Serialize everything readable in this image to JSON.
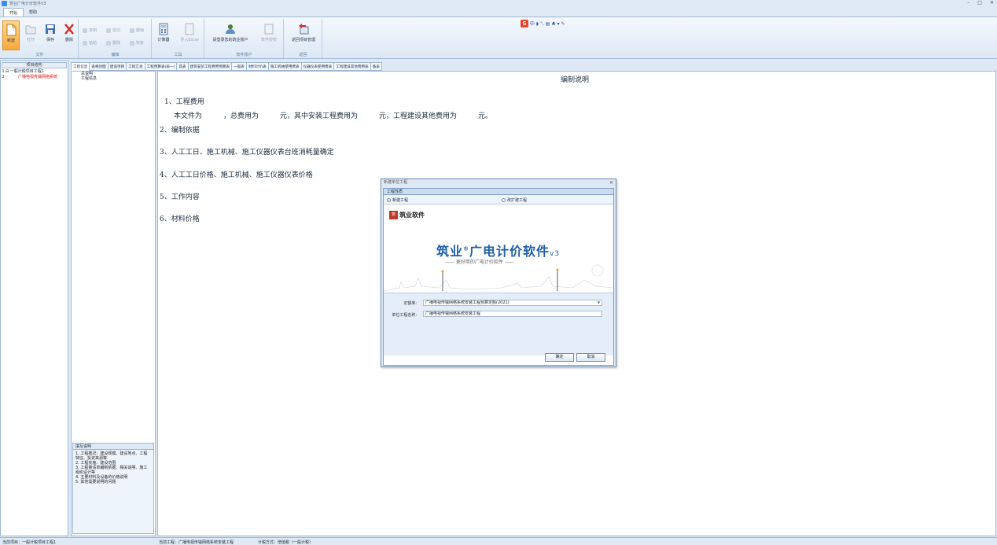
{
  "window": {
    "title": "筑业广电计价软件V3",
    "controls": [
      "–",
      "□",
      "✕"
    ]
  },
  "ribbon_tabs": [
    "开始",
    "帮助"
  ],
  "ribbon": {
    "file_group": {
      "label": "文件",
      "new": "新建",
      "open": "打开",
      "save": "保存",
      "delete": "删除"
    },
    "edit_group": {
      "label": "编辑",
      "copy": "复制",
      "paste": "粘贴",
      "cut": "剪切",
      "remove": "删除",
      "undo": "撤销",
      "redo": "恢复"
    },
    "tools_group": {
      "label": "工具",
      "calculator": "计算器",
      "import_excel": "导入Excel"
    },
    "account_group": {
      "label": "软件账户",
      "login": "请登录您的筑业账户",
      "auth": "软件授权"
    },
    "return_group": {
      "label": "返回",
      "back": "返回项目管理"
    }
  },
  "ime_toolbar": {
    "logo": "S",
    "glyphs": "中 ◗ °, ▤ ♣ ▾ ✎"
  },
  "left_panel": {
    "header": "项目结构",
    "items": [
      {
        "num": "1",
        "text": "⊟ 一般计税项目工程1"
      },
      {
        "num": "2",
        "text": "广播电视传输网络系统"
      }
    ]
  },
  "middle_panel": {
    "items": [
      "总说明",
      "工程信息"
    ],
    "notes_header": "填写说明",
    "notes": [
      "1. 工程概况：建设规模、建设地点、工程特征、投资来源等",
      "2. 工程实施、建设范围",
      "3. 工程量清单编制依据、相关说明、施工组织设计等",
      "4. 主要材料及设备的价格说明",
      "5. 其他需要说明的问题"
    ]
  },
  "doc_tabs": [
    "工程信息",
    "表格封面",
    "建设项目",
    "工程汇总",
    "工程预算表(表一)",
    "其表",
    "建筑安装工程费用预算表",
    "一般表",
    "材料计价表",
    "施工机械使用费表",
    "仪器仪表使用费表",
    "工程建设其他费用表",
    "备表"
  ],
  "document": {
    "title": "编制说明",
    "item1": "1、工程费用",
    "item1_body": "本文件为　　　，总费用为　　　元，其中安装工程费用为　　　元，工程建设其他费用为　　　元。",
    "item2": "2、编制依据",
    "item3": "3、人工工日、施工机械、施工仪器仪表台班消耗量确定",
    "item4": "4、人工工日价格、施工机械、施工仪器仪表价格",
    "item5": "5、工作内容",
    "item6": "6、材料价格"
  },
  "dialog": {
    "title": "新建单位工程",
    "close": "✕",
    "subheader": "工程性质",
    "radio_new": "新建工程",
    "radio_expand": "改扩建工程",
    "logo_text": "筑业软件",
    "brand": "筑业",
    "product": "广电计价软件",
    "version": "v3",
    "slogan": "—— 更好用的广电计价软件 ——",
    "field_standard_label": "定额库:",
    "field_standard_value": "广播电视传输网络系统安装工程预算定额(2021)",
    "field_name_label": "单位工程名称:",
    "field_name_value": "广播电视传输网络系统安装工程",
    "ok": "确定",
    "cancel": "取消"
  },
  "status": {
    "project": "当前项目：一般计税项目工程1",
    "current": "当前工程：广播电视传输网络系统安装工程",
    "tax": "计税方式：增值税（一般计税）"
  },
  "colors": {
    "accent": "#1f5fa8",
    "highlight": "#f7a93a",
    "red_item": "#e01010"
  }
}
